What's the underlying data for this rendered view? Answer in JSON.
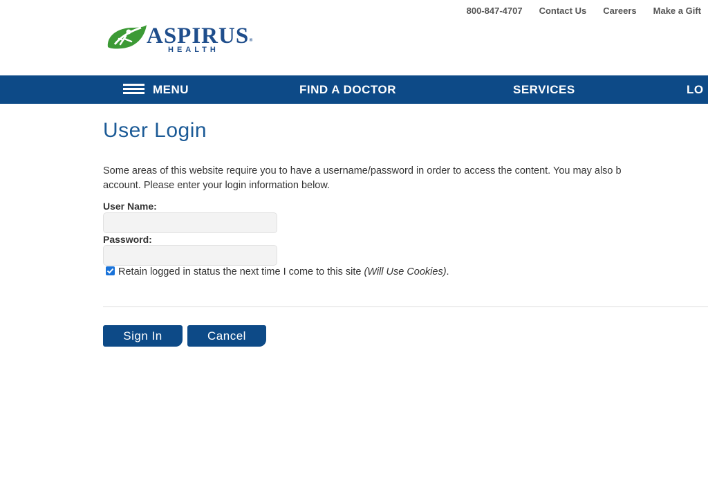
{
  "utility_nav": {
    "phone": "800-847-4707",
    "contact": "Contact Us",
    "careers": "Careers",
    "gift": "Make a Gift"
  },
  "logo": {
    "name": "ASPIRUS",
    "registered": "®",
    "sub": "HEALTH",
    "brand_blue": "#1f4e8c",
    "brand_green": "#3c9a35"
  },
  "nav": {
    "menu": "MENU",
    "find_doctor": "FIND A DOCTOR",
    "services": "SERVICES",
    "locations_partial": "LO",
    "background": "#0d4a87"
  },
  "page": {
    "title": "User Login",
    "intro_line1": "Some areas of this website require you to have a username/password in order to access the content. You may also b",
    "intro_line2": "account. Please enter your login information below."
  },
  "form": {
    "username_label": "User Name:",
    "username_value": "",
    "password_label": "Password:",
    "password_value": "",
    "retain_checked": true,
    "retain_text": "Retain logged in status the next time I come to this site",
    "retain_note": "(Will Use Cookies)",
    "retain_period": ".",
    "sign_in": "Sign In",
    "cancel": "Cancel"
  }
}
